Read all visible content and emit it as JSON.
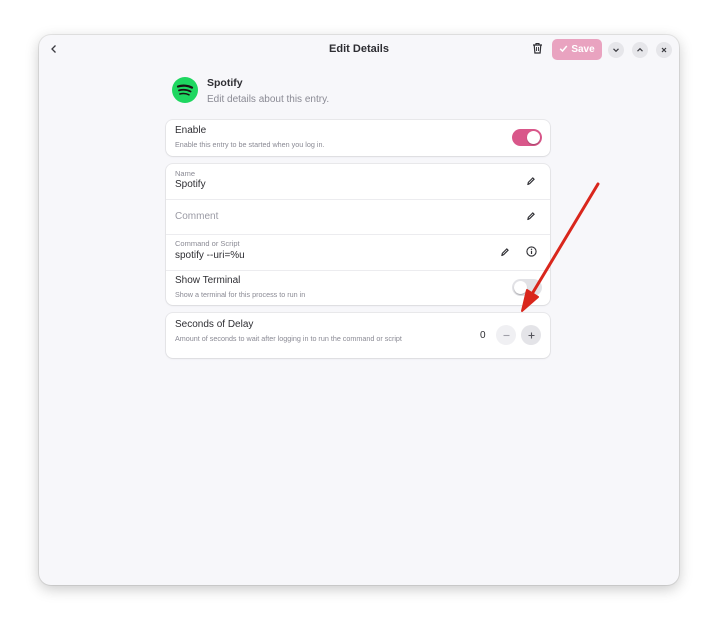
{
  "header": {
    "title": "Edit Details",
    "save_label": "Save",
    "icons": [
      "back-chevron-icon",
      "trash-icon",
      "check-icon",
      "chevron-down-icon",
      "chevron-up-icon",
      "close-icon"
    ]
  },
  "app": {
    "name": "Spotify",
    "subtitle": "Edit details about this entry.",
    "icon": "spotify-logo-icon",
    "brand_color": "#1ed760"
  },
  "enable": {
    "label": "Enable",
    "description": "Enable this entry to be started when you log in.",
    "state": true
  },
  "fields": {
    "name": {
      "label": "Name",
      "value": "Spotify"
    },
    "comment": {
      "placeholder": "Comment",
      "value": ""
    },
    "command": {
      "label": "Command or Script",
      "value": "spotify --uri=%u"
    },
    "show_terminal": {
      "label": "Show Terminal",
      "description": "Show a terminal for this process to run in",
      "state": false
    }
  },
  "delay": {
    "label": "Seconds of Delay",
    "description": "Amount of seconds to wait after logging in to run the command or script",
    "value": "0"
  },
  "colors": {
    "accent": "#d9578a",
    "save_button": "#e9a3c0",
    "annotation_arrow": "#d9261c"
  }
}
